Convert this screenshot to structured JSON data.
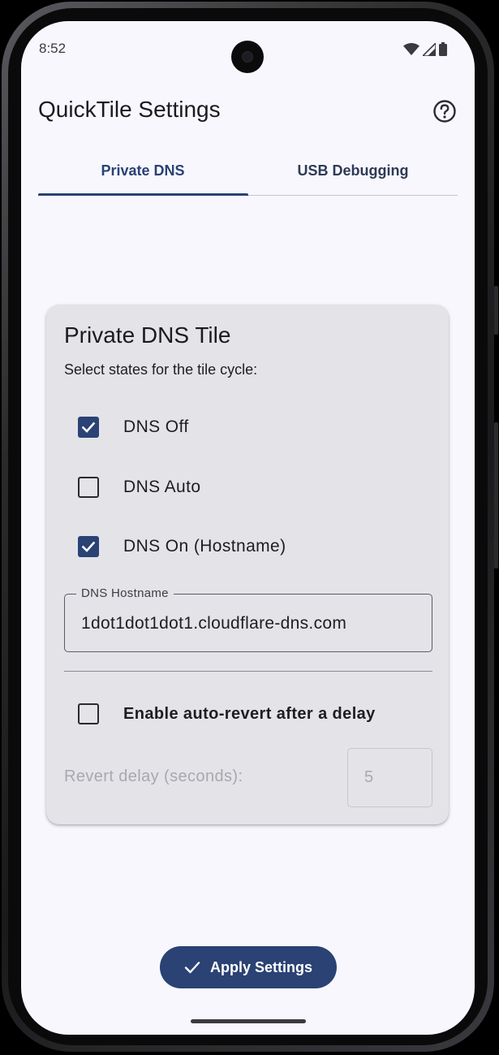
{
  "status_bar": {
    "time": "8:52",
    "icons": [
      "wifi-icon",
      "signal-icon",
      "battery-icon"
    ]
  },
  "app_bar": {
    "title": "QuickTile Settings",
    "help_icon": "help-circle-icon"
  },
  "tabs": [
    {
      "label": "Private DNS",
      "selected": true
    },
    {
      "label": "USB Debugging",
      "selected": false
    }
  ],
  "card": {
    "title": "Private DNS Tile",
    "subtitle": "Select states for the tile cycle:",
    "options": [
      {
        "label": "DNS Off",
        "checked": true
      },
      {
        "label": "DNS Auto",
        "checked": false
      },
      {
        "label": "DNS On (Hostname)",
        "checked": true
      }
    ],
    "hostname_field": {
      "label": "DNS Hostname",
      "value": "1dot1dot1dot1.cloudflare-dns.com"
    },
    "auto_revert": {
      "label": "Enable auto-revert after a delay",
      "checked": false
    },
    "revert_delay": {
      "label": "Revert delay (seconds):",
      "value": "5"
    }
  },
  "apply_button": {
    "label": "Apply Settings",
    "icon": "check-icon"
  },
  "colors": {
    "primary": "#2a4274",
    "background": "#f8f7fd",
    "card": "#e4e3e8",
    "disabled_text": "#a9a8ae"
  }
}
